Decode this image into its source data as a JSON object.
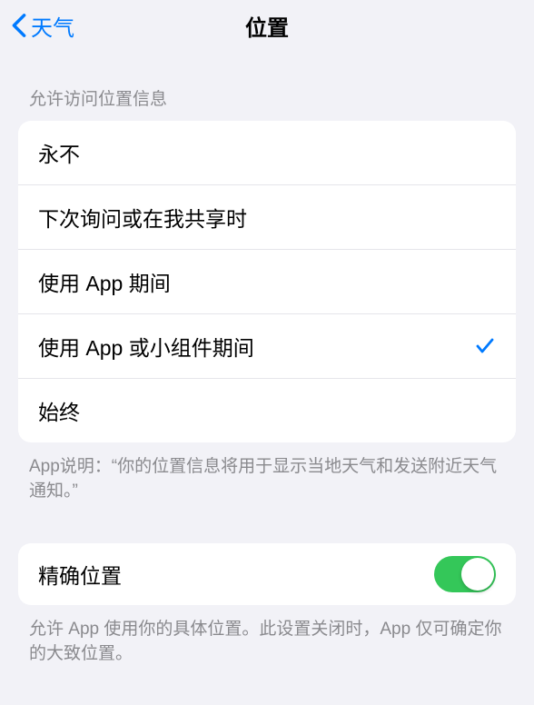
{
  "nav": {
    "back_label": "天气",
    "title": "位置"
  },
  "section1": {
    "header": "允许访问位置信息",
    "options": [
      {
        "label": "永不",
        "selected": false
      },
      {
        "label": "下次询问或在我共享时",
        "selected": false
      },
      {
        "label": "使用 App 期间",
        "selected": false
      },
      {
        "label": "使用 App 或小组件期间",
        "selected": true
      },
      {
        "label": "始终",
        "selected": false
      }
    ],
    "footer": "App说明：“你的位置信息将用于显示当地天气和发送附近天气通知。”"
  },
  "section2": {
    "precise_label": "精确位置",
    "precise_enabled": true,
    "footer": "允许 App 使用你的具体位置。此设置关闭时，App 仅可确定你的大致位置。"
  }
}
